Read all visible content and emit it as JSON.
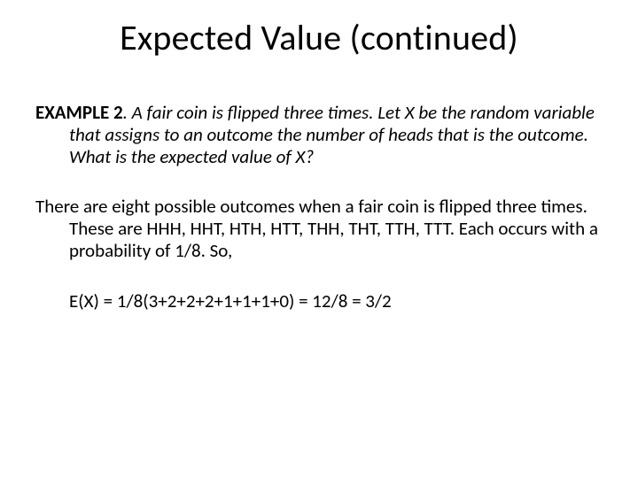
{
  "title": "Expected Value (continued)",
  "example_label": "EXAMPLE 2",
  "dot_space": ". ",
  "problem": "A fair coin is flipped three times. Let X be the random variable that assigns to an outcome the number of heads that is the outcome. What is the expected value of X?",
  "explanation": "There are eight possible outcomes when a fair coin is flipped three times. These are HHH, HHT, HTH, HTT, THH, THT, TTH, TTT. Each occurs with a probability of 1/8. So,",
  "formula": "E(X) = 1/8(3+2+2+2+1+1+1+0) =  12/8 = 3/2"
}
